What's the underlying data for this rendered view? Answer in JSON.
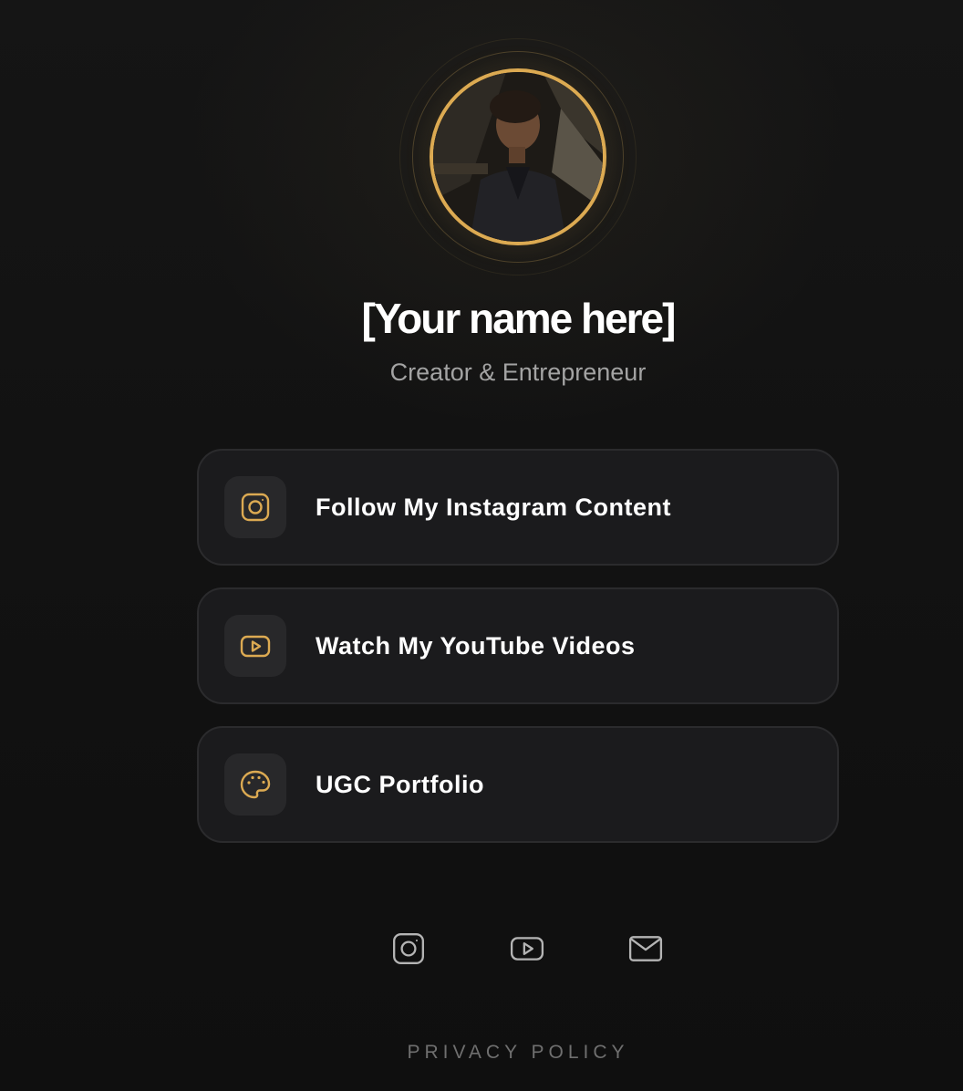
{
  "profile": {
    "name": "[Your name here]",
    "subtitle": "Creator & Entrepreneur",
    "avatar": "profile-photo"
  },
  "links": [
    {
      "label": "Follow My Instagram Content",
      "icon": "instagram-icon"
    },
    {
      "label": "Watch My YouTube Videos",
      "icon": "youtube-icon"
    },
    {
      "label": "UGC Portfolio",
      "icon": "palette-icon"
    }
  ],
  "footer": {
    "socials": [
      "instagram-icon",
      "youtube-icon",
      "mail-icon"
    ],
    "privacy_label": "PRIVACY POLICY"
  },
  "colors": {
    "accent": "#dcaa52",
    "background": "#111111",
    "card": "#1b1b1d",
    "text": "#ffffff",
    "muted": "#a3a3a3"
  }
}
